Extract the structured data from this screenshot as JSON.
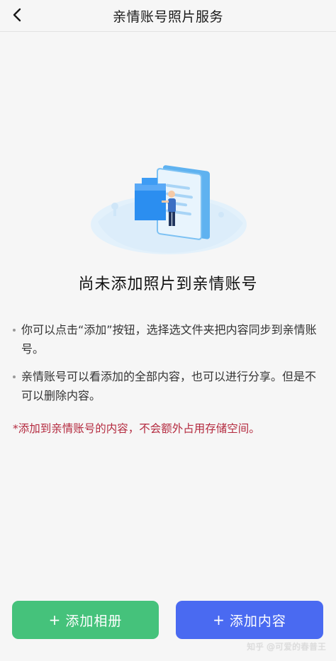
{
  "header": {
    "title": "亲情账号照片服务"
  },
  "empty_state": {
    "title": "尚未添加照片到亲情账号",
    "notes": [
      "你可以点击“添加”按钮，选择选文件夹把内容同步到亲情账号。",
      "亲情账号可以看添加的全部内容，也可以进行分享。但是不可以删除内容。"
    ],
    "warning": "*添加到亲情账号的内容，不会额外占用存储空间。"
  },
  "actions": {
    "add_album": "添加相册",
    "add_content": "添加内容",
    "plus": "+"
  },
  "watermark": "知乎 @可爱的春普王",
  "colors": {
    "add_album_bg": "#45c27b",
    "add_content_bg": "#4a6af1",
    "warning_text": "#b42a3f"
  },
  "icons": {
    "back": "chevron-left-icon",
    "illustration": "empty-folder-person-illustration"
  }
}
